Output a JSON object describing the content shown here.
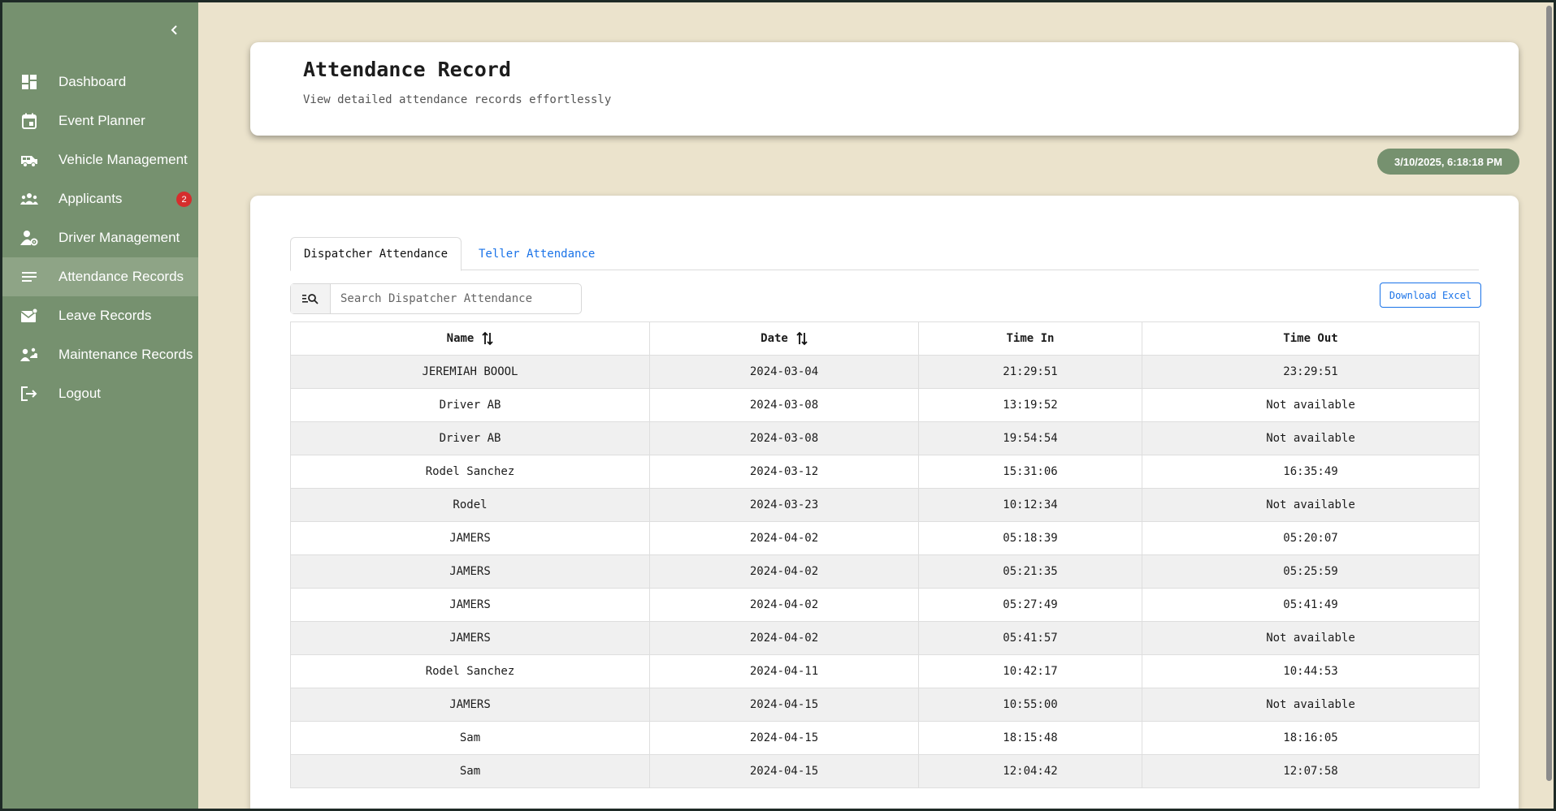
{
  "sidebar": {
    "items": [
      {
        "label": "Dashboard",
        "icon": "dashboard-icon"
      },
      {
        "label": "Event Planner",
        "icon": "calendar-icon"
      },
      {
        "label": "Vehicle Management",
        "icon": "van-icon"
      },
      {
        "label": "Applicants",
        "icon": "people-icon",
        "badge": "2"
      },
      {
        "label": "Driver Management",
        "icon": "user-gear-icon"
      },
      {
        "label": "Attendance Records",
        "icon": "list-icon",
        "active": true
      },
      {
        "label": "Leave Records",
        "icon": "mail-icon"
      },
      {
        "label": "Maintenance Records",
        "icon": "team-icon"
      },
      {
        "label": "Logout",
        "icon": "logout-icon"
      }
    ]
  },
  "header": {
    "title": "Attendance Record",
    "subtitle": "View detailed attendance records effortlessly"
  },
  "datetime": "3/10/2025, 6:18:18 PM",
  "tabs": [
    {
      "label": "Dispatcher Attendance",
      "active": true
    },
    {
      "label": "Teller Attendance",
      "active": false
    }
  ],
  "search": {
    "placeholder": "Search Dispatcher Attendance"
  },
  "download_label": "Download Excel",
  "table": {
    "columns": [
      "Name",
      "Date",
      "Time In",
      "Time Out"
    ],
    "rows": [
      [
        "JEREMIAH BOOOL",
        "2024-03-04",
        "21:29:51",
        "23:29:51"
      ],
      [
        "Driver AB",
        "2024-03-08",
        "13:19:52",
        "Not available"
      ],
      [
        "Driver AB",
        "2024-03-08",
        "19:54:54",
        "Not available"
      ],
      [
        "Rodel Sanchez",
        "2024-03-12",
        "15:31:06",
        "16:35:49"
      ],
      [
        "Rodel",
        "2024-03-23",
        "10:12:34",
        "Not available"
      ],
      [
        "JAMERS",
        "2024-04-02",
        "05:18:39",
        "05:20:07"
      ],
      [
        "JAMERS",
        "2024-04-02",
        "05:21:35",
        "05:25:59"
      ],
      [
        "JAMERS",
        "2024-04-02",
        "05:27:49",
        "05:41:49"
      ],
      [
        "JAMERS",
        "2024-04-02",
        "05:41:57",
        "Not available"
      ],
      [
        "Rodel Sanchez",
        "2024-04-11",
        "10:42:17",
        "10:44:53"
      ],
      [
        "JAMERS",
        "2024-04-15",
        "10:55:00",
        "Not available"
      ],
      [
        "Sam",
        "2024-04-15",
        "18:15:48",
        "18:16:05"
      ],
      [
        "Sam",
        "2024-04-15",
        "12:04:42",
        "12:07:58"
      ]
    ]
  },
  "colors": {
    "sidebar": "#76916f",
    "sidebar_active": "#8ea486",
    "background": "#ebe3cc",
    "accent_link": "#1a73e8",
    "badge": "#d62d2d"
  }
}
